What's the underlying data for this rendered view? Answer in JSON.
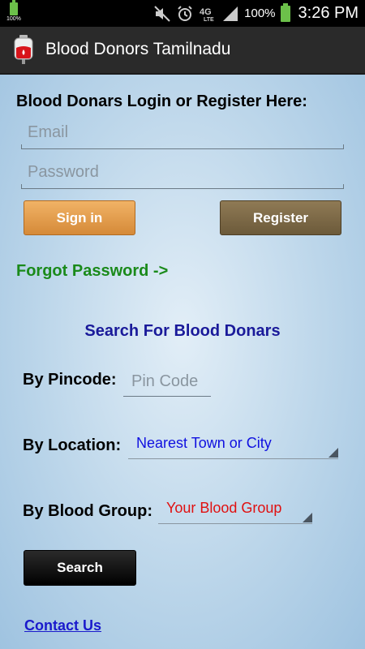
{
  "status_bar": {
    "small_battery_pct": "100%",
    "battery_pct": "100%",
    "network": "4G LTE",
    "time": "3:26 PM"
  },
  "action_bar": {
    "title": "Blood Donors Tamilnadu",
    "icon": "blood-bag-icon"
  },
  "login": {
    "heading": "Blood Donars Login or Register Here:",
    "email_placeholder": "Email",
    "email_value": "",
    "password_placeholder": "Password",
    "password_value": "",
    "signin_label": "Sign in",
    "register_label": "Register",
    "forgot_label": "Forgot Password ->"
  },
  "search": {
    "heading": "Search For Blood Donars",
    "pincode_label": "By Pincode:",
    "pincode_placeholder": "Pin Code",
    "location_label": "By Location:",
    "location_selected": "Nearest Town or City",
    "blood_group_label": "By Blood Group:",
    "blood_group_selected": "Your Blood Group",
    "search_button": "Search"
  },
  "contact_label": "Contact Us",
  "colors": {
    "signin_button": "#d58a38",
    "register_button": "#6c5a3a",
    "forgot_link": "#1a8a1a",
    "search_heading": "#1a1a9a",
    "location_text": "#1010e0",
    "blood_group_text": "#e01010",
    "contact_link": "#1a1acc"
  }
}
